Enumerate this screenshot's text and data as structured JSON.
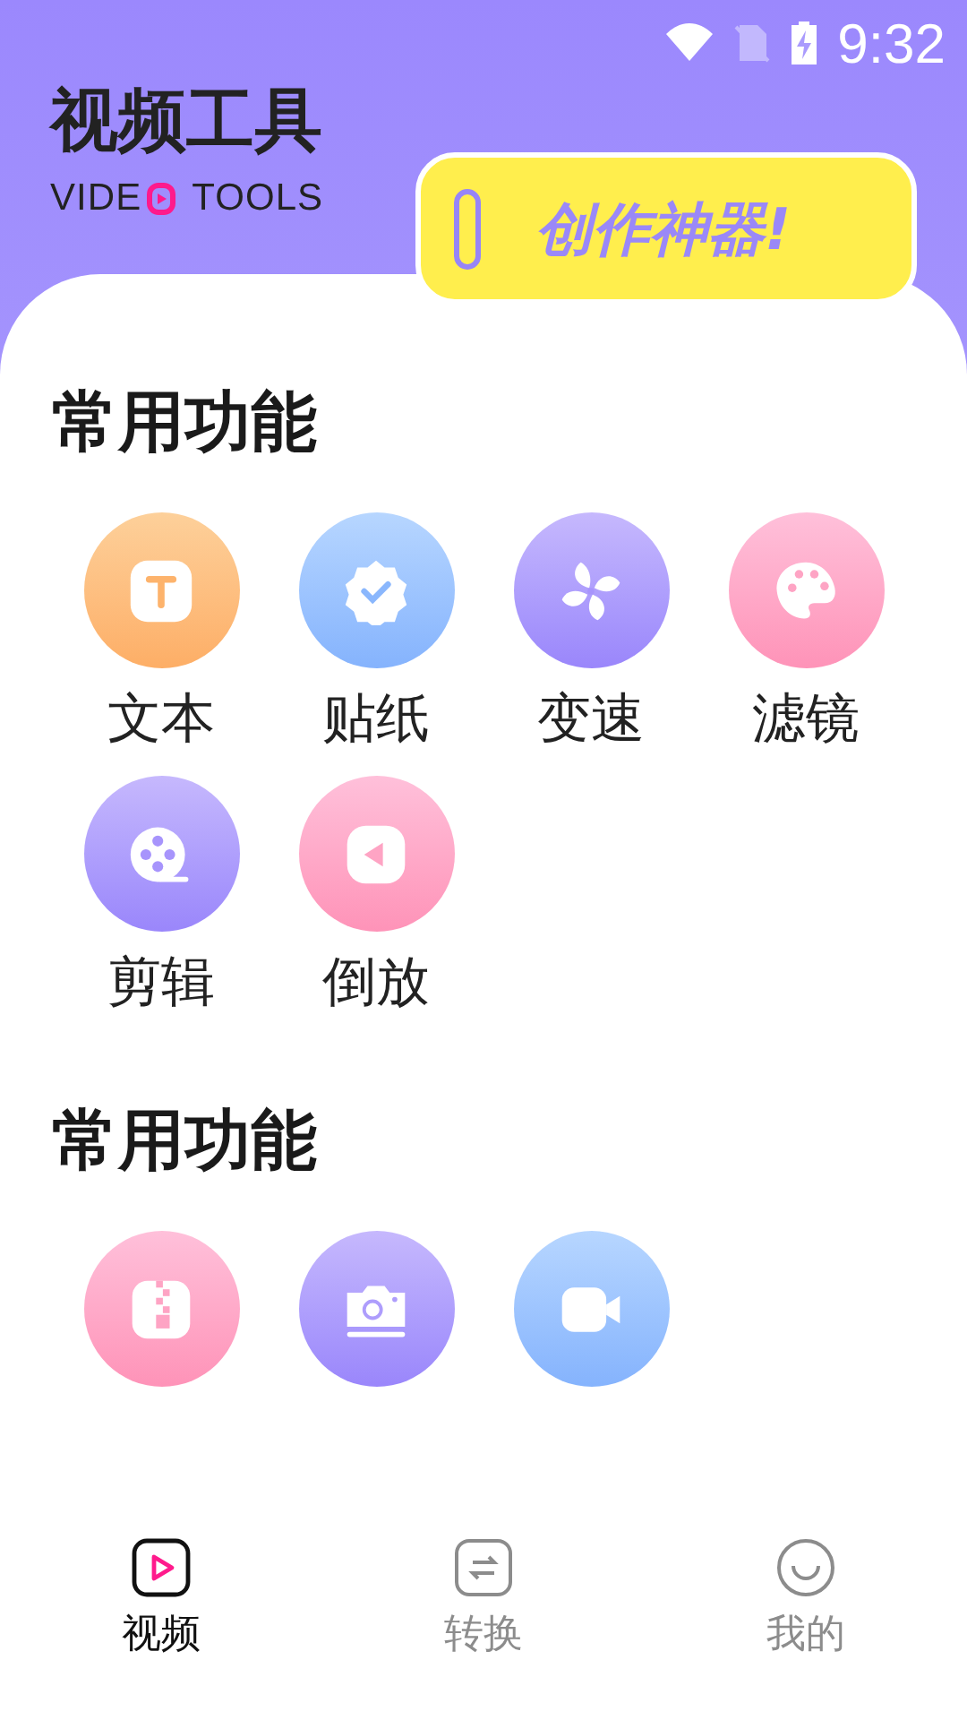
{
  "status_bar": {
    "time": "9:32"
  },
  "header": {
    "title": "视频工具",
    "subtitle_left": "VIDE",
    "subtitle_right": "TOOLS",
    "badge": "创作神器!"
  },
  "sections": [
    {
      "title": "常用功能",
      "items": [
        {
          "label": "文本",
          "kind": "text"
        },
        {
          "label": "贴纸",
          "kind": "sticker"
        },
        {
          "label": "变速",
          "kind": "speed"
        },
        {
          "label": "滤镜",
          "kind": "filter"
        },
        {
          "label": "剪辑",
          "kind": "edit"
        },
        {
          "label": "倒放",
          "kind": "reverse"
        }
      ]
    },
    {
      "title": "常用功能",
      "items": [
        {
          "kind": "compress"
        },
        {
          "kind": "camera"
        },
        {
          "kind": "record"
        }
      ]
    }
  ],
  "nav": [
    {
      "label": "视频",
      "kind": "video",
      "selected": true
    },
    {
      "label": "转换",
      "kind": "convert",
      "selected": false
    },
    {
      "label": "我的",
      "kind": "profile",
      "selected": false
    }
  ]
}
